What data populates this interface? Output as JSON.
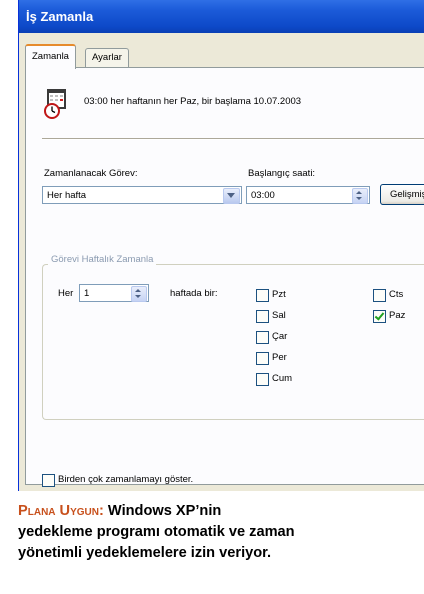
{
  "window": {
    "title": "İş Zamanla"
  },
  "tabs": [
    {
      "label": "Zamanla"
    },
    {
      "label": "Ayarlar"
    }
  ],
  "summary": {
    "text": "03:00 her haftanın her Paz, bir başlama 10.07.2003"
  },
  "schedule_task": {
    "label": "Zamanlanacak Görev:",
    "value": "Her hafta"
  },
  "start_time": {
    "label": "Başlangıç saati:",
    "value": "03:00"
  },
  "advanced_button": {
    "label": "Gelişmiş"
  },
  "weekly_group": {
    "title": "Görevi Haftalık Zamanla",
    "every_label": "Her",
    "weeks_value": "1",
    "weeks_suffix": "haftada bir:",
    "days": [
      {
        "label": "Pzt",
        "checked": false
      },
      {
        "label": "Sal",
        "checked": false
      },
      {
        "label": "Çar",
        "checked": false
      },
      {
        "label": "Per",
        "checked": false
      },
      {
        "label": "Cum",
        "checked": false
      },
      {
        "label": "Cts",
        "checked": false
      },
      {
        "label": "Paz",
        "checked": true
      }
    ]
  },
  "show_multiple": {
    "label": "Birden çok zamanlamayı göster.",
    "checked": false
  },
  "caption": {
    "kicker": "Plana Uygun:",
    "line1": "Windows XP’nin",
    "line2": "yedekleme programı otomatik ve zaman",
    "line3": "yönetimli yedeklemelere izin veriyor."
  }
}
